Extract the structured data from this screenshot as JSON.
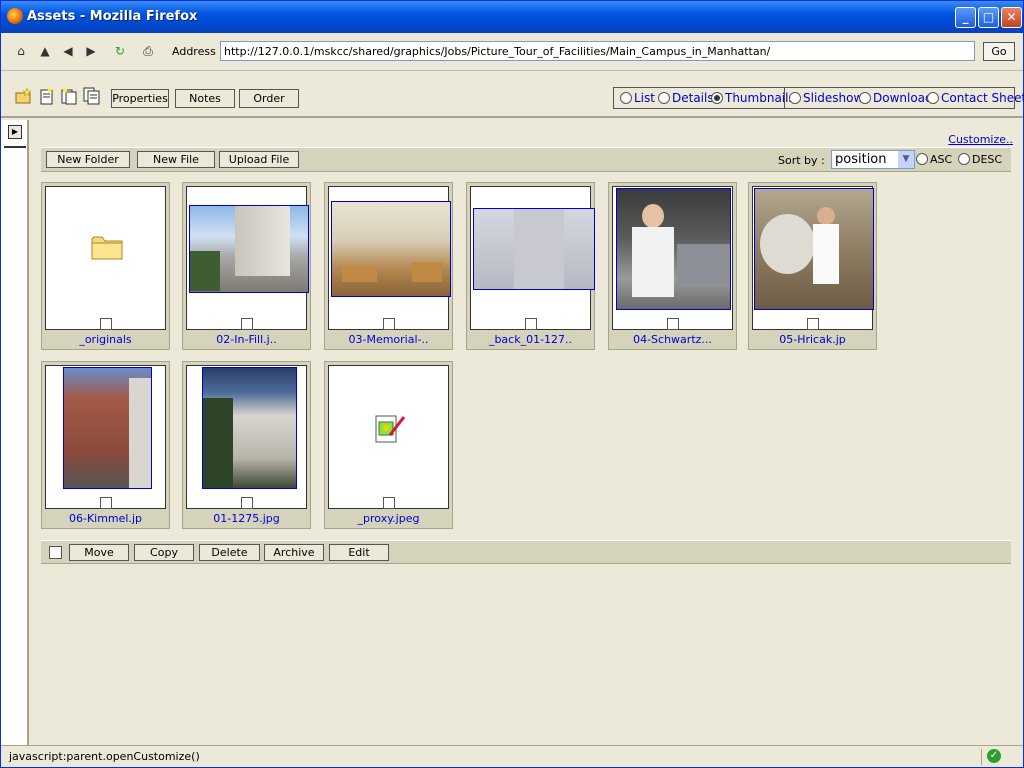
{
  "window": {
    "title": "Assets - Mozilla Firefox"
  },
  "nav": {
    "address_label": "Address :",
    "url": "http://127.0.0.1/mskcc/shared/graphics/Jobs/Picture_Tour_of_Facilities/Main_Campus_in_Manhattan/",
    "go_label": "Go"
  },
  "toolbar": {
    "properties_label": "Properties",
    "notes_label": "Notes",
    "order_label": "Order",
    "views": [
      {
        "label": "List",
        "selected": false
      },
      {
        "label": "Details",
        "selected": false
      },
      {
        "label": "Thumbnails",
        "selected": true
      },
      {
        "label": "Slideshow",
        "selected": false
      },
      {
        "label": "Download",
        "selected": false
      },
      {
        "label": "Contact Sheet",
        "selected": false
      }
    ]
  },
  "content": {
    "customize_label": "Customize..",
    "new_folder_label": "New Folder",
    "new_file_label": "New File",
    "upload_file_label": "Upload File",
    "sort_label": "Sort by :",
    "sort_value": "position",
    "asc_label": "ASC",
    "desc_label": "DESC",
    "items": [
      {
        "caption": "_originals",
        "type": "folder"
      },
      {
        "caption": "02-In-Fill.j..",
        "type": "image"
      },
      {
        "caption": "03-Memorial-..",
        "type": "image"
      },
      {
        "caption": "_back_01-127..",
        "type": "image"
      },
      {
        "caption": "04-Schwartz...",
        "type": "image"
      },
      {
        "caption": "05-Hricak.jp",
        "type": "image"
      },
      {
        "caption": "06-Kimmel.jp",
        "type": "image"
      },
      {
        "caption": "01-1275.jpg",
        "type": "image"
      },
      {
        "caption": "_proxy.jpeg",
        "type": "generic"
      }
    ],
    "move_label": "Move",
    "copy_label": "Copy",
    "delete_label": "Delete",
    "archive_label": "Archive",
    "edit_label": "Edit"
  },
  "status": {
    "text": "javascript:parent.openCustomize()"
  }
}
